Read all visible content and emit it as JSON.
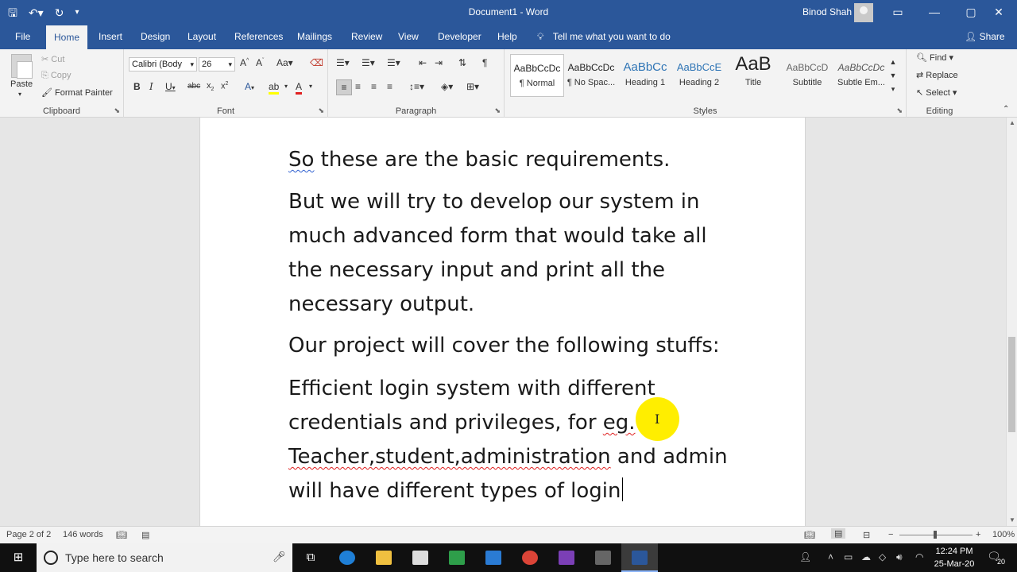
{
  "titlebar": {
    "doc_title": "Document1 - Word",
    "user_name": "Binod Shah",
    "qat_icons": [
      "save-icon",
      "undo-icon",
      "redo-icon",
      "customize-qat-icon"
    ],
    "window_buttons": [
      "ribbon-display-icon",
      "minimize-icon",
      "maximize-icon",
      "close-icon"
    ]
  },
  "tabs": {
    "items": [
      "File",
      "Home",
      "Insert",
      "Design",
      "Layout",
      "References",
      "Mailings",
      "Review",
      "View",
      "Developer",
      "Help"
    ],
    "active": "Home",
    "tell_me": "Tell me what you want to do",
    "share": "Share"
  },
  "ribbon": {
    "clipboard": {
      "paste": "Paste",
      "cut": "Cut",
      "copy": "Copy",
      "format_painter": "Format Painter",
      "label": "Clipboard"
    },
    "font": {
      "family": "Calibri (Body",
      "size": "26",
      "label": "Font"
    },
    "paragraph": {
      "label": "Paragraph"
    },
    "styles": {
      "label": "Styles",
      "items": [
        {
          "preview": "AaBbCcDc",
          "name": "¶ Normal"
        },
        {
          "preview": "AaBbCcDc",
          "name": "¶ No Spac..."
        },
        {
          "preview": "AaBbCc",
          "name": "Heading 1"
        },
        {
          "preview": "AaBbCcE",
          "name": "Heading 2"
        },
        {
          "preview": "AaB",
          "name": "Title"
        },
        {
          "preview": "AaBbCcD",
          "name": "Subtitle"
        },
        {
          "preview": "AaBbCcDc",
          "name": "Subtle Em..."
        }
      ]
    },
    "editing": {
      "find": "Find",
      "replace": "Replace",
      "select": "Select",
      "label": "Editing"
    }
  },
  "document": {
    "p1_word1": "So",
    "p1_rest": " these are the basic requirements.",
    "p2": "But we will try to develop our system in much advanced form that would take all the necessary input and print all the necessary output.",
    "p3": "Our project will cover the following stuffs:",
    "p4_a": "Efficient login system with different credentials and privileges, for ",
    "p4_eg": "eg.",
    "p4_space": " ",
    "p4_err": "Teacher,student,administration",
    "p4_b": " and admin will have different types of login"
  },
  "statusbar": {
    "page": "Page 2 of 2",
    "words": "146 words",
    "zoom": "100%"
  },
  "taskbar": {
    "search_placeholder": "Type here to search",
    "time": "12:24 PM",
    "date": "25-Mar-20",
    "notification_count": "20"
  },
  "colors": {
    "word_blue": "#2b579a",
    "cursor_highlight": "#ffee00",
    "spell_error": "#e02020"
  }
}
